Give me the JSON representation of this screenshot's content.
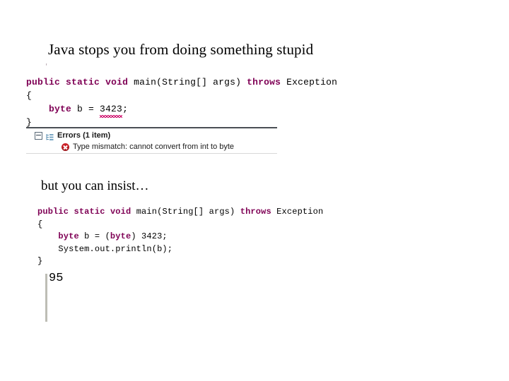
{
  "slide": {
    "title": "Java stops you from doing something stupid",
    "subtitle": "but you can insist…",
    "background_color": "#ffffff"
  },
  "colors": {
    "keyword": "#7f0055",
    "text": "#000000",
    "error_red": "#cc2127",
    "squiggle": "#cc0066",
    "panel_rule": "#4a4f55",
    "console_rule": "#bdbdb5"
  },
  "code_block_1": {
    "name": "error-example-code",
    "ghost_mark": "'",
    "lines": [
      {
        "tokens": [
          {
            "text": "public",
            "kind": "keyword"
          },
          {
            "text": " ",
            "kind": "plain"
          },
          {
            "text": "static",
            "kind": "keyword"
          },
          {
            "text": " ",
            "kind": "plain"
          },
          {
            "text": "void",
            "kind": "keyword"
          },
          {
            "text": " main(String[] args) ",
            "kind": "plain"
          },
          {
            "text": "throws",
            "kind": "keyword"
          },
          {
            "text": " Exception",
            "kind": "plain"
          }
        ]
      },
      {
        "tokens": [
          {
            "text": "{",
            "kind": "plain"
          }
        ]
      },
      {
        "tokens": [
          {
            "text": "    ",
            "kind": "plain"
          },
          {
            "text": "byte",
            "kind": "keyword"
          },
          {
            "text": " b = ",
            "kind": "plain"
          },
          {
            "text": "3423",
            "kind": "error"
          },
          {
            "text": ";",
            "kind": "plain"
          }
        ]
      },
      {
        "tokens": [
          {
            "text": "}",
            "kind": "plain"
          }
        ]
      }
    ]
  },
  "problems_panel": {
    "header_label": "Errors (1 item)",
    "collapse_state": "expanded",
    "items": [
      {
        "severity": "error",
        "message": "Type mismatch: cannot convert from int to byte"
      }
    ]
  },
  "code_block_2": {
    "name": "cast-example-code",
    "lines": [
      {
        "tokens": [
          {
            "text": "public",
            "kind": "keyword"
          },
          {
            "text": " ",
            "kind": "plain"
          },
          {
            "text": "static",
            "kind": "keyword"
          },
          {
            "text": " ",
            "kind": "plain"
          },
          {
            "text": "void",
            "kind": "keyword"
          },
          {
            "text": " main(String[] args) ",
            "kind": "plain"
          },
          {
            "text": "throws",
            "kind": "keyword"
          },
          {
            "text": " Exception",
            "kind": "plain"
          }
        ]
      },
      {
        "tokens": [
          {
            "text": "{",
            "kind": "plain"
          }
        ]
      },
      {
        "tokens": [
          {
            "text": "    ",
            "kind": "plain"
          },
          {
            "text": "byte",
            "kind": "keyword"
          },
          {
            "text": " b = (",
            "kind": "plain"
          },
          {
            "text": "byte",
            "kind": "keyword"
          },
          {
            "text": ") 3423;",
            "kind": "plain"
          }
        ]
      },
      {
        "tokens": [
          {
            "text": "    System.out.println(b);",
            "kind": "plain"
          }
        ]
      },
      {
        "tokens": [
          {
            "text": "}",
            "kind": "plain"
          }
        ]
      }
    ]
  },
  "console": {
    "output": "95"
  }
}
